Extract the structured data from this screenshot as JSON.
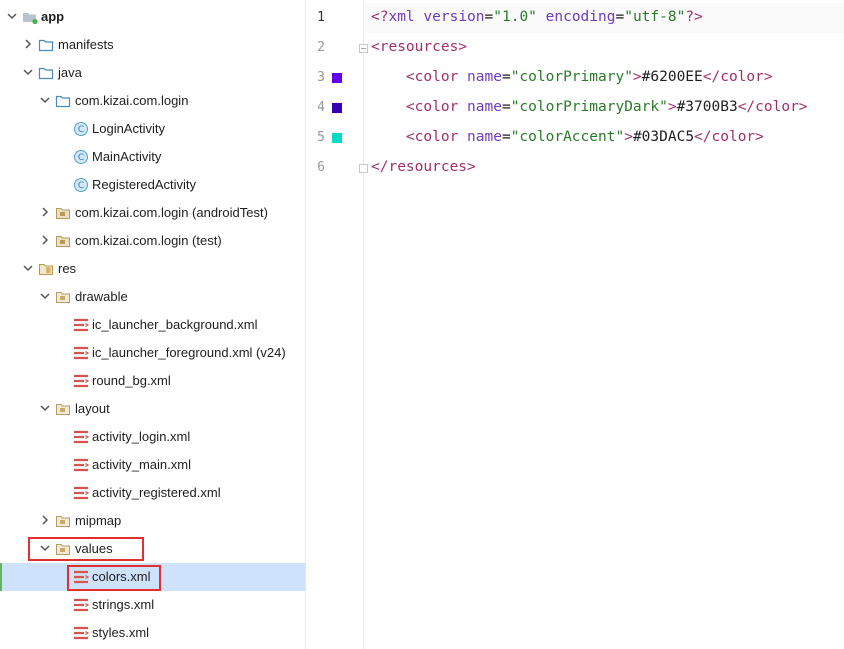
{
  "project_tree": {
    "root": {
      "label": "app"
    },
    "manifests": {
      "label": "manifests"
    },
    "java": {
      "label": "java"
    },
    "package_main": {
      "label": "com.kizai.com.login"
    },
    "classes": [
      {
        "label": "LoginActivity"
      },
      {
        "label": "MainActivity"
      },
      {
        "label": "RegisteredActivity"
      }
    ],
    "package_android_test": {
      "label": "com.kizai.com.login (androidTest)"
    },
    "package_test": {
      "label": "com.kizai.com.login (test)"
    },
    "res": {
      "label": "res"
    },
    "drawable": {
      "label": "drawable"
    },
    "drawable_files": [
      {
        "label": "ic_launcher_background.xml"
      },
      {
        "label": "ic_launcher_foreground.xml (v24)"
      },
      {
        "label": "round_bg.xml"
      }
    ],
    "layout": {
      "label": "layout"
    },
    "layout_files": [
      {
        "label": "activity_login.xml"
      },
      {
        "label": "activity_main.xml"
      },
      {
        "label": "activity_registered.xml"
      }
    ],
    "mipmap": {
      "label": "mipmap"
    },
    "values": {
      "label": "values"
    },
    "values_files": [
      {
        "label": "colors.xml",
        "selected": true
      },
      {
        "label": "strings.xml"
      },
      {
        "label": "styles.xml"
      }
    ]
  },
  "editor": {
    "line_numbers": [
      "1",
      "2",
      "3",
      "4",
      "5",
      "6"
    ],
    "current_line": "1",
    "lines": {
      "l1": {
        "prolog_open": "<?",
        "xml": "xml",
        "attr1": "version",
        "eq1": "=",
        "val1": "\"1.0\"",
        "attr2": "encoding",
        "eq2": "=",
        "val2": "\"utf-8\"",
        "prolog_close": "?>"
      },
      "l2": {
        "tag": "<resources>"
      },
      "l3": {
        "open": "<color",
        "attr": "name",
        "eq": "=",
        "val": "\"colorPrimary\"",
        "gt": ">",
        "text": "#6200EE",
        "close": "</color>"
      },
      "l4": {
        "open": "<color",
        "attr": "name",
        "eq": "=",
        "val": "\"colorPrimaryDark\"",
        "gt": ">",
        "text": "#3700B3",
        "close": "</color>"
      },
      "l5": {
        "open": "<color",
        "attr": "name",
        "eq": "=",
        "val": "\"colorAccent\"",
        "gt": ">",
        "text": "#03DAC5",
        "close": "</color>"
      },
      "l6": {
        "tag": "</resources>"
      }
    },
    "swatches": {
      "colorPrimary": "#6200EE",
      "colorPrimaryDark": "#3700B3",
      "colorAccent": "#03DAC5"
    }
  },
  "highlight_color": "#e03030"
}
